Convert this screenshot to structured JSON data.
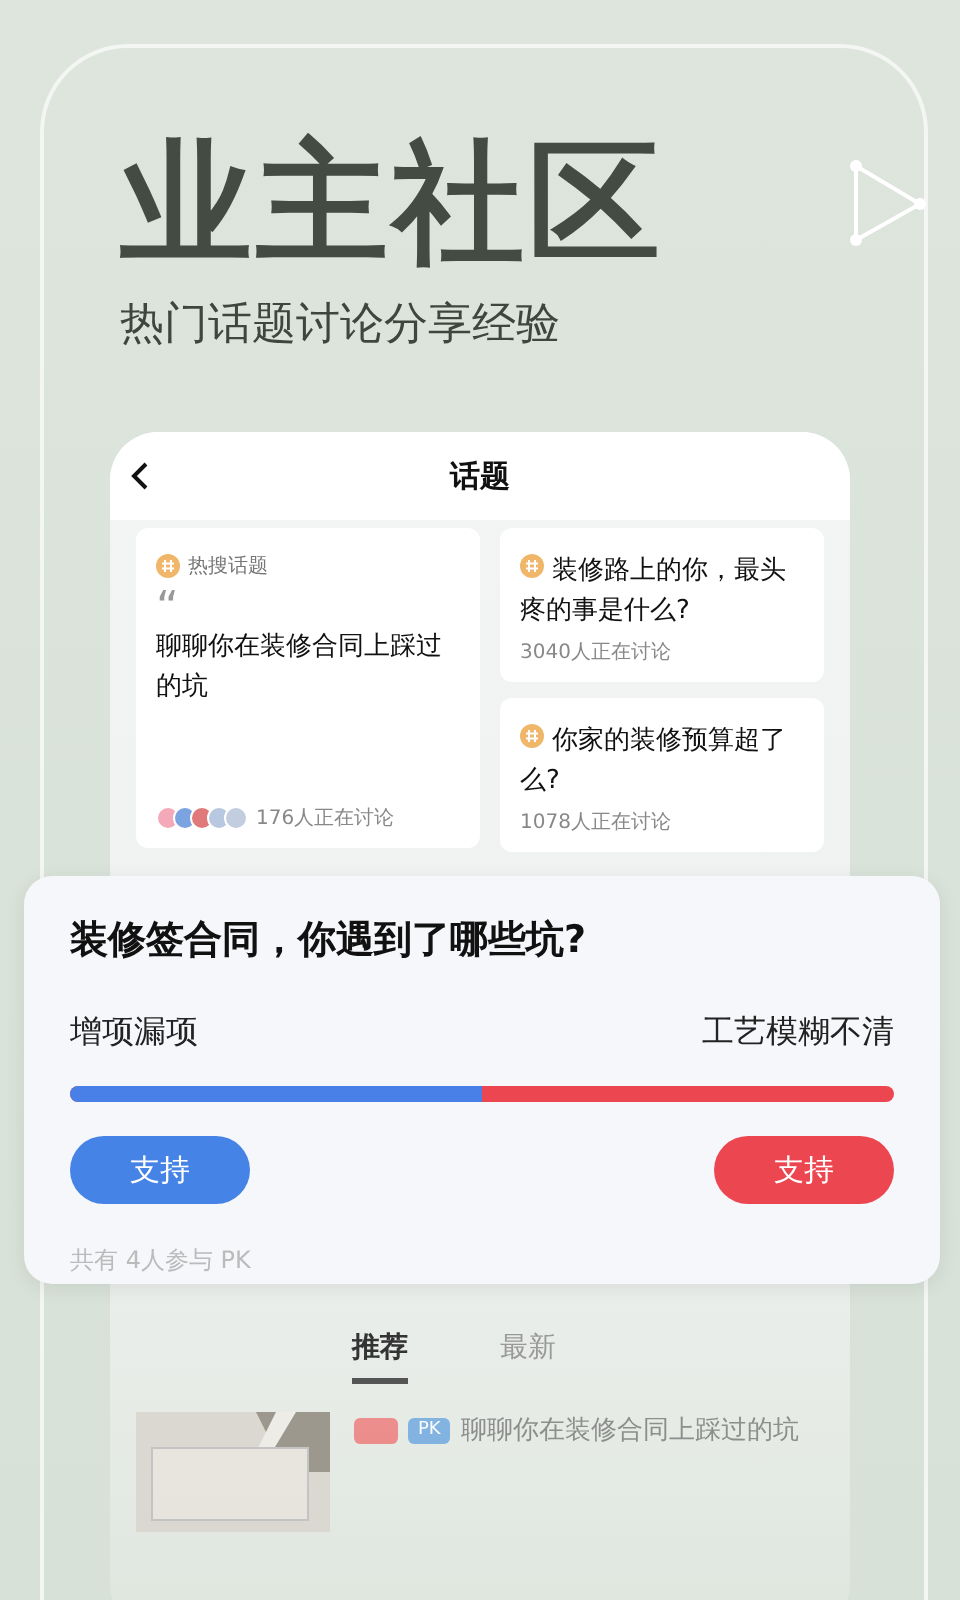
{
  "headline": "业主社区",
  "subtitle": "热门话题讨论分享经验",
  "screen": {
    "title": "话题",
    "featured": {
      "tag": "热搜话题",
      "quote_mark": "“",
      "title": "聊聊你在装修合同上踩过的坑",
      "count": "176人正在讨论"
    },
    "topics": [
      {
        "title": "装修路上的你，最头疼的事是什么?",
        "count": "3040人正在讨论"
      },
      {
        "title": "你家的装修预算超了么?",
        "count": "1078人正在讨论"
      }
    ],
    "tabs": [
      {
        "label": "推荐",
        "selected": true
      },
      {
        "label": "最新",
        "selected": false
      }
    ],
    "post": {
      "tag": "PK",
      "title": "聊聊你在装修合同上踩过的坑"
    }
  },
  "pk": {
    "question": "装修签合同，你遇到了哪些坑?",
    "left": "增项漏项",
    "right": "工艺模糊不清",
    "level": 0.5,
    "left_button": "支持",
    "right_button": "支持",
    "participants": "共有 4人参与 PK"
  }
}
